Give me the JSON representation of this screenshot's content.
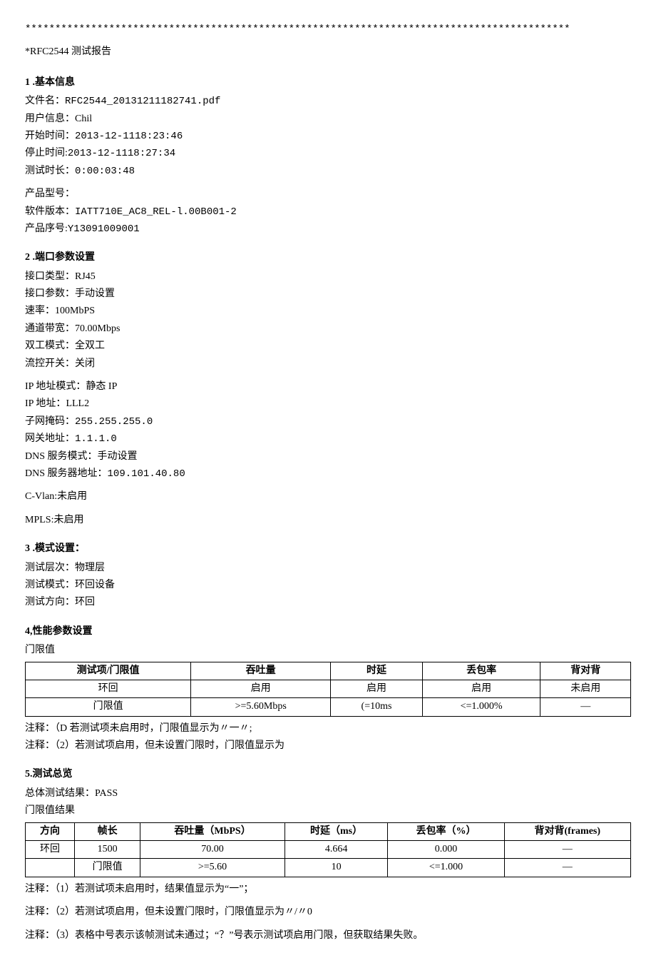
{
  "divider": "*******************************************************************************************",
  "report_title": "*RFC2544 测试报告",
  "sections": {
    "s1": {
      "header": "1 .基本信息",
      "filename_label": "文件名：",
      "filename": "RFC2544_20131211182741.pdf",
      "user_label": "用户信息：",
      "user": "Chil",
      "start_label": "开始时间：",
      "start": "2013-12-1118:23:46",
      "stop_label": "停止时间:",
      "stop": "2013-12-1118:27:34",
      "duration_label": "测试时长：",
      "duration": "0:00:03:48",
      "model_label": "产品型号：",
      "model": "",
      "sw_label": "软件版本：",
      "sw": "IATT710E_AC8_REL-l.00B001-2",
      "serial_label": "产品序号:",
      "serial": "Y13091009001"
    },
    "s2": {
      "header": "2 .端口参数设置",
      "iface_type_label": "接口类型：",
      "iface_type": "RJ45",
      "iface_param_label": "接口参数：",
      "iface_param": "手动设置",
      "rate_label": "速率：",
      "rate": "100MbPS",
      "bw_label": "通道带宽：",
      "bw": "70.00Mbps",
      "duplex_label": "双工模式：",
      "duplex": "全双工",
      "flow_label": "流控开关：",
      "flow": "关闭",
      "ipmode_label": "IP 地址模式：",
      "ipmode": "静态 IP",
      "ip_label": "IP 地址：",
      "ip": "LLL2",
      "mask_label": "子网掩码：",
      "mask": "255.255.255.0",
      "gw_label": "网关地址：",
      "gw": "1.1.1.0",
      "dnsmode_label": "DNS 服务模式：",
      "dnsmode": "手动设置",
      "dns_label": "DNS 服务器地址：",
      "dns": "109.101.40.80",
      "cvlan_label": "C-Vlan:",
      "cvlan": "未启用",
      "mpls_label": "MPLS:",
      "mpls": "未启用"
    },
    "s3": {
      "header": "3 .模式设置：",
      "layer_label": "测试层次：",
      "layer": "物理层",
      "mode_label": "测试模式：",
      "mode": "环回设备",
      "dir_label": "测试方向：",
      "dir": "环回"
    },
    "s4": {
      "header": "4,性能参数设置",
      "sub": "门限值",
      "table": {
        "headers": [
          "测试项/门限值",
          "吞吐量",
          "时延",
          "丢包率",
          "背对背"
        ],
        "rows": [
          [
            "环回",
            "启用",
            "启用",
            "启用",
            "未启用"
          ],
          [
            "门限值",
            ">=5.60Mbps",
            "(=10ms",
            "<=1.000%",
            "—"
          ]
        ]
      },
      "note1": "注释：（D 若测试项未启用时，门限值显示为〃一〃;",
      "note2": "注释：（2）若测试项启用，但未设置门限时，门限值显示为"
    },
    "s5": {
      "header": "5.测试总览",
      "overall_label": "总体测试结果：",
      "overall": "PASS",
      "sub": "门限值结果",
      "table": {
        "headers": [
          "方向",
          "帧长",
          "吞吐量（MbPS）",
          "时延（ms）",
          "丢包率（%）",
          "背对背(frames)"
        ],
        "rows": [
          [
            "环回",
            "1500",
            "70.00",
            "4.664",
            "0.000",
            "—"
          ],
          [
            "",
            "门限值",
            ">=5.60",
            "10",
            "<=1.000",
            "—"
          ]
        ]
      },
      "note1": "注释：（1）若测试项未启用时，结果值显示为“一”；",
      "note2": "注释：（2）若测试项启用，但未设置门限时，门限值显示为〃/〃0",
      "note3": "注释：（3）表格中号表示该帧测试未通过；“？”号表示测试项启用门限，但获取结果失败。"
    }
  }
}
